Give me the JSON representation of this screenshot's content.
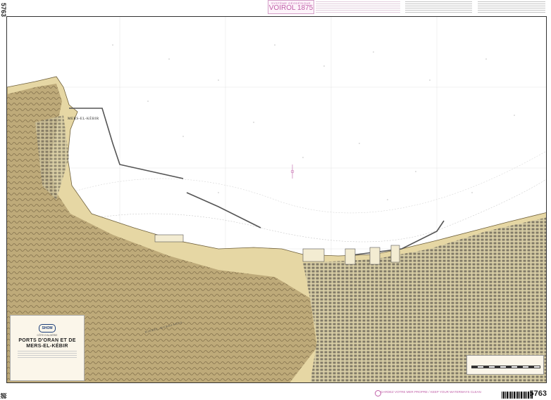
{
  "sheet_number": "5763",
  "geodesy": {
    "line1": "SYSTÈME GÉODÉSIQUE",
    "line2": "VOIROL 1875"
  },
  "labels": {
    "mers_el_kebir": "MERS-EL-KÉBIR",
    "djebel": "DJEBEL MURDJADJO"
  },
  "cartouche": {
    "logo": "SHOM",
    "region": "CÔTE D'ALGÉRIE",
    "title": "PORTS D'ORAN ET DE MERS-EL-KÉBIR"
  },
  "colors": {
    "land": "#e6d7a4",
    "relief": "#8c7a52",
    "water": "#ffffff",
    "urban": "#6f6a5c",
    "accent": "#c060a8"
  },
  "footer": {
    "clean": "GARDEZ VOTRE MER PROPRE / KEEP YOUR WATERWAYS CLEAN"
  }
}
